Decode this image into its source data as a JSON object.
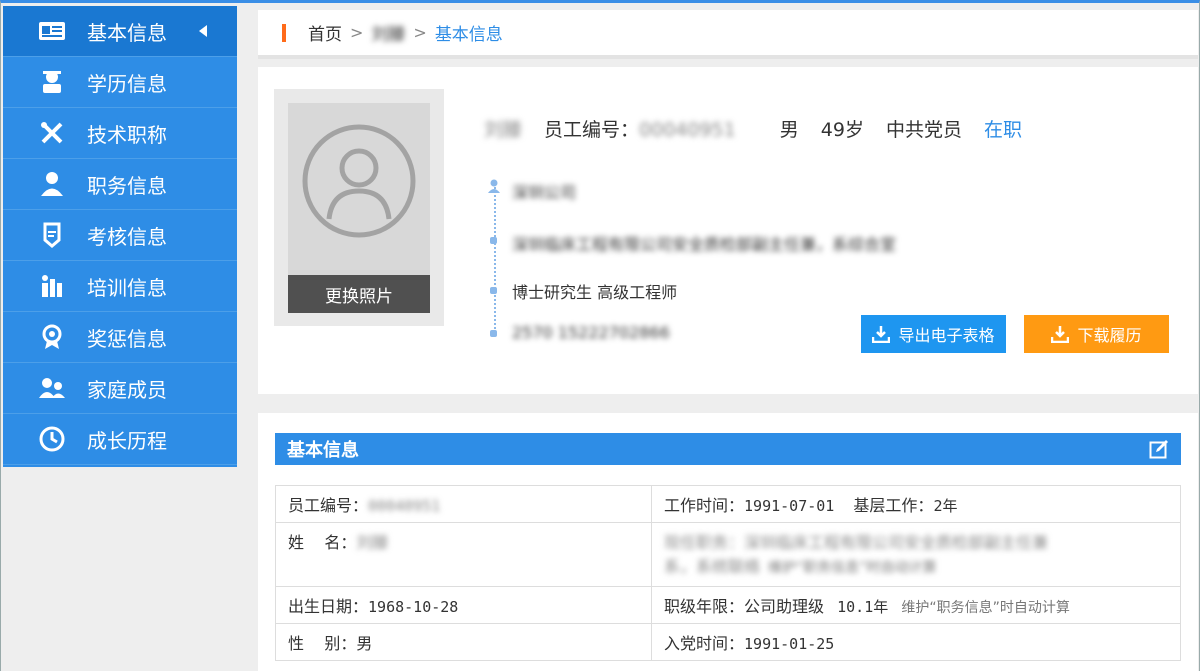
{
  "sidebar": {
    "items": [
      {
        "label": "基本信息",
        "icon": "id-card-icon",
        "active": true
      },
      {
        "label": "学历信息",
        "icon": "graduate-icon",
        "active": false
      },
      {
        "label": "技术职称",
        "icon": "tools-icon",
        "active": false
      },
      {
        "label": "职务信息",
        "icon": "user-tie-icon",
        "active": false
      },
      {
        "label": "考核信息",
        "icon": "assessment-icon",
        "active": false
      },
      {
        "label": "培训信息",
        "icon": "training-icon",
        "active": false
      },
      {
        "label": "奖惩信息",
        "icon": "award-icon",
        "active": false
      },
      {
        "label": "家庭成员",
        "icon": "family-icon",
        "active": false
      },
      {
        "label": "成长历程",
        "icon": "clock-icon",
        "active": false
      }
    ]
  },
  "breadcrumb": {
    "home": "首页",
    "middle": "刘滕",
    "current": "基本信息",
    "separator": ">"
  },
  "profile": {
    "name": "刘滕",
    "employee_no_label": "员工编号：",
    "employee_no": "00040951",
    "gender": "男",
    "age": "49岁",
    "party": "中共党员",
    "status": "在职",
    "change_photo": "更换照片",
    "timeline": {
      "org": "深圳公司",
      "position": "深圳临床工程有限公司安全质检部副主任兼，系综合室",
      "education_title": "博士研究生  高级工程师",
      "contact": "2570  15222702866"
    },
    "export_button": "导出电子表格",
    "download_button": "下载履历"
  },
  "info": {
    "title": "基本信息",
    "rows": [
      {
        "left_label": "员工编号：",
        "left_value": "00040951",
        "right_label": "工作时间：",
        "right_value": "1991-07-01",
        "right_extra_label": "基层工作：",
        "right_extra_value": "2年"
      },
      {
        "left_label": "姓    名：",
        "left_value": "刘滕",
        "right_value_line1": "现任职务：深圳临床工程有限公司安全质检部副主任兼",
        "right_value_line2": "系，系统联络",
        "right_hint": "维护“职务信息”时自动计算"
      },
      {
        "left_label": "出生日期：",
        "left_value": "1968-10-28",
        "right_label": "职级年限：",
        "right_value": "公司助理级",
        "right_extra_value": "10.1年",
        "right_hint": "维护“职务信息”时自动计算"
      },
      {
        "left_label": "性    别：",
        "left_value": "男",
        "right_label": "入党时间：",
        "right_value": "1991-01-25"
      }
    ]
  },
  "colors": {
    "sidebar": "#2e8de6",
    "accent": "#2e8de6",
    "orange": "#ff9a12",
    "breadcrumb_bar": "#ff6b1a"
  }
}
